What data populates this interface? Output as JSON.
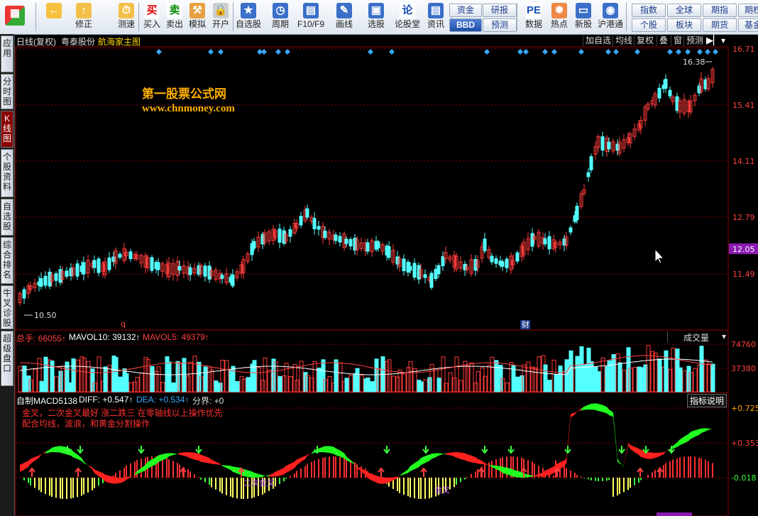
{
  "toolbar": {
    "buttons": [
      {
        "label": "",
        "icon": "logo-icon"
      },
      {
        "label": "",
        "icon": "back-arrow-icon"
      },
      {
        "label": "修正",
        "icon": "fix-icon"
      },
      {
        "label": "测速",
        "icon": "speed-icon"
      },
      {
        "label": "买入",
        "icon": "buy-icon",
        "glyph": "买"
      },
      {
        "label": "卖出",
        "icon": "sell-icon",
        "glyph": "卖"
      },
      {
        "label": "模拟",
        "icon": "hammer-icon"
      },
      {
        "label": "开户",
        "icon": "lock-icon"
      },
      {
        "label": "自选股",
        "icon": "star-icon"
      },
      {
        "label": "周期",
        "icon": "clock-icon"
      },
      {
        "label": "F10/F9",
        "icon": "f10-icon"
      },
      {
        "label": "画线",
        "icon": "pencil-icon"
      },
      {
        "label": "选股",
        "icon": "screen-icon"
      },
      {
        "label": "论股堂",
        "icon": "forum-icon",
        "glyph": "论"
      },
      {
        "label": "资讯",
        "icon": "news-icon"
      },
      {
        "label": "数据",
        "icon": "pe-icon",
        "glyph": "PE"
      },
      {
        "label": "热点",
        "icon": "fire-icon"
      },
      {
        "label": "新股",
        "icon": "ipo-icon"
      },
      {
        "label": "沪港通",
        "icon": "hk-icon"
      }
    ],
    "pills": [
      {
        "label": "资金",
        "style": "normal"
      },
      {
        "label": "BBD",
        "style": "blue"
      },
      {
        "label": "研报",
        "style": "normal"
      },
      {
        "label": "预测",
        "style": "normal"
      },
      {
        "label": "指数",
        "style": "normal"
      },
      {
        "label": "全球",
        "style": "normal"
      },
      {
        "label": "期指",
        "style": "normal"
      },
      {
        "label": "期权",
        "style": "normal"
      },
      {
        "label": "个股",
        "style": "normal"
      },
      {
        "label": "板块",
        "style": "normal"
      },
      {
        "label": "期货",
        "style": "normal"
      },
      {
        "label": "基金",
        "style": "normal"
      }
    ]
  },
  "sidebar": {
    "tabs": [
      {
        "label": "应用",
        "active": false
      },
      {
        "label": "分时图",
        "active": false
      },
      {
        "label": "K线图",
        "active": true
      },
      {
        "label": "个股资料",
        "active": false
      },
      {
        "label": "自选股",
        "active": false
      },
      {
        "label": "综合排名",
        "active": false
      },
      {
        "label": "牛叉诊股",
        "active": false
      },
      {
        "label": "超级盘口",
        "active": false
      }
    ]
  },
  "kline": {
    "period_label": "日线(复权)",
    "stock_name": "粤泰股份",
    "indicator_name": "航海家主图",
    "right_buttons": [
      "加自选",
      "均线",
      "复权",
      "叠",
      "窗",
      "预测"
    ],
    "watermark_title": "第一股票公式网",
    "watermark_url": "www.chnmoney.com",
    "high_marker": "16.38",
    "low_marker": "10.50",
    "event_q": "q",
    "event_cai": "财",
    "price_axis": [
      "16.71",
      "15.41",
      "14.11",
      "12.79",
      "11.49"
    ],
    "current_price": "12.05",
    "colors": {
      "up": "#ff3b3b",
      "down": "#54ffff",
      "diamond": "#3aa8ff",
      "grid": "#8b0000"
    }
  },
  "volume": {
    "total_label": "总手: 66055↑",
    "mavol10_label": "MAVOL10: 39132↑",
    "mavol5_label": "MAVOL5: 49379↑",
    "dropdown_label": "成交量",
    "axis": [
      "74760",
      "37380"
    ]
  },
  "macd": {
    "title_label": "自制MACD5138",
    "diff_label": "DIFF: +0.547↑",
    "dea_label": "DEA: +0.534↑",
    "boundary_label": "分界: +0",
    "help_button": "指标说明",
    "note_line1": "金叉，二次金叉最好     涨二跌三   在零轴线以上操作优先",
    "note_line2": "配合均线，波浪，和黄金分割操作",
    "cross_label_1": "二次金叉",
    "cross_label_2": "金叉",
    "axis": [
      "+0.725",
      "+0.353",
      "-0.018"
    ]
  }
}
